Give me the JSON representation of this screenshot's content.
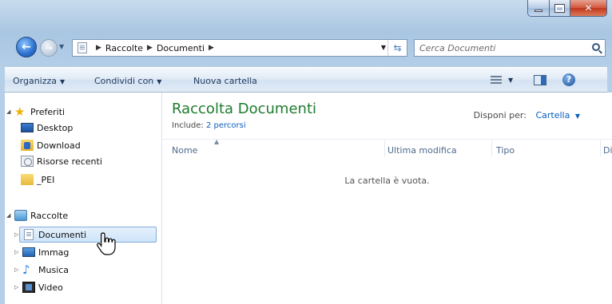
{
  "window": {
    "close_glyph": "✕"
  },
  "nav": {
    "back_icon": "back-arrow-icon",
    "forward_icon": "forward-arrow-icon",
    "breadcrumbs": [
      "Raccolte",
      "Documenti"
    ],
    "search_placeholder": "Cerca Documenti"
  },
  "toolbar": {
    "organize": "Organizza",
    "share": "Condividi con",
    "new_folder": "Nuova cartella",
    "help": "?"
  },
  "sidebar": {
    "favorites_label": "Preferiti",
    "favorites": [
      "Desktop",
      "Download",
      "Risorse recenti",
      "_PEI"
    ],
    "libraries_label": "Raccolte",
    "libraries": [
      "Documenti",
      "Immagini",
      "Musica",
      "Video"
    ],
    "libraries_shown": [
      "Documenti",
      "Immag",
      "Musica",
      "Video"
    ]
  },
  "content": {
    "title": "Raccolta Documenti",
    "include_prefix": "Include:",
    "include_link": "2 percorsi",
    "arrange_label": "Disponi per:",
    "arrange_value": "Cartella",
    "columns": [
      "Nome",
      "Ultima modifica",
      "Tipo",
      "Di"
    ],
    "empty_message": "La cartella è vuota."
  },
  "colors": {
    "title_green": "#1e7b2e",
    "link_blue": "#0b5fbf",
    "selection": "#cde4fa",
    "close_red": "#c2361c"
  }
}
